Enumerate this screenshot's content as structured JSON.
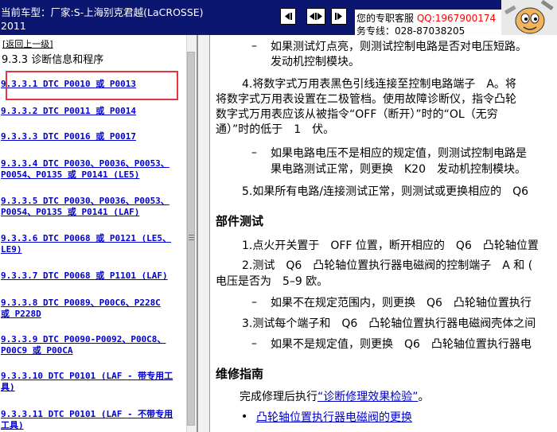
{
  "header": {
    "vehicle_line1": "当前车型：厂家:S-上海别克君越(LaCROSSE)",
    "vehicle_line2": "2011",
    "nav_buttons": [
      "previous-button",
      "toggle-button",
      "next-button"
    ],
    "service": {
      "qq_label": "您的专职客服",
      "qq_number": "QQ:1967900174",
      "tel": "务专线：028-87038205"
    }
  },
  "left": {
    "back_link": "[返回上一级]",
    "section_title": "9.3.3 诊断信息和程序",
    "toc": [
      {
        "line1": "9.3.3.1 DTC P0010 或 P0013",
        "line2": ""
      },
      {
        "line1": "9.3.3.2 DTC P0011 或 P0014",
        "line2": ""
      },
      {
        "line1": "9.3.3.3 DTC P0016 或 P0017",
        "line2": ""
      },
      {
        "line1": "9.3.3.4 DTC P0030、P0036、P0053、",
        "line2": "P0054、P0135 或 P0141 (LE5)"
      },
      {
        "line1": "9.3.3.5 DTC P0030、P0036、P0053、",
        "line2": "P0054、P0135 或 P0141 (LAF)"
      },
      {
        "line1": "9.3.3.6 DTC P0068 或 P0121 (LE5、",
        "line2": "LE9)"
      },
      {
        "line1": "9.3.3.7 DTC P0068 或 P1101 (LAF)",
        "line2": ""
      },
      {
        "line1": "9.3.3.8 DTC P0089、P00C6、P228C",
        "line2": "或 P228D"
      },
      {
        "line1": "9.3.3.9 DTC P0090-P0092、P00C8、",
        "line2": "P00C9 或 P00CA"
      },
      {
        "line1": "9.3.3.10 DTC P0101 (LAF - 带专用工",
        "line2": "具)"
      },
      {
        "line1": "9.3.3.11 DTC P0101 (LAF - 不带专用",
        "line2": "工具)"
      }
    ]
  },
  "right": {
    "b1_dash": "–",
    "b1_l1": "如果测试灯点亮，则测试控制电路是否对电压短路。",
    "b1_l2": "发动机控制模块。",
    "s4_l1": "4.将数字式万用表黑色引线连接至控制电路端子　A。将",
    "s4_l2": "将数字式万用表设置在二极管档。使用故障诊断仪，指令凸轮",
    "s4_l3": "数字式万用表应该从被指令“OFF（断开）”时的“OL（无穷",
    "s4_l4": "通）”时的低于　1　伏。",
    "b2_dash": "–",
    "b2_l1": "如果电路电压不是相应的规定值，则测试控制电路是",
    "b2_l2": "果电路测试正常，则更换　K20　发动机控制模块。",
    "s5": "5.如果所有电路/连接测试正常，则测试或更换相应的　Q6",
    "h_component": "部件测试",
    "c1": "1.点火开关置于　OFF 位置，断开相应的　Q6　凸轮轴位置",
    "c2_l1": "2.测试　Q6　凸轮轴位置执行器电磁阀的控制端子　A 和 (",
    "c2_l2": "电压是否为　5–9 欧。",
    "b3_dash": "–",
    "b3": "如果不在规定范围内，则更换　Q6　凸轮轴位置执行",
    "c3": "3.测试每个端子和　Q6　凸轮轴位置执行器电磁阀壳体之间",
    "b4_dash": "–",
    "b4": "如果不是规定值，则更换　Q6　凸轮轴位置执行器电",
    "h_repair": "维修指南",
    "repair_prefix": "完成修理后执行",
    "repair_link": "“诊断修理效果检验”",
    "repair_suffix": "。",
    "bullet": "•",
    "bullet_link": "凸轮轴位置执行器电磁阀的更换"
  },
  "colors": {
    "header_bg": "#0b1670",
    "link": "#0000cc",
    "qq": "#ff0000",
    "highlight_box": "#e8343d"
  }
}
